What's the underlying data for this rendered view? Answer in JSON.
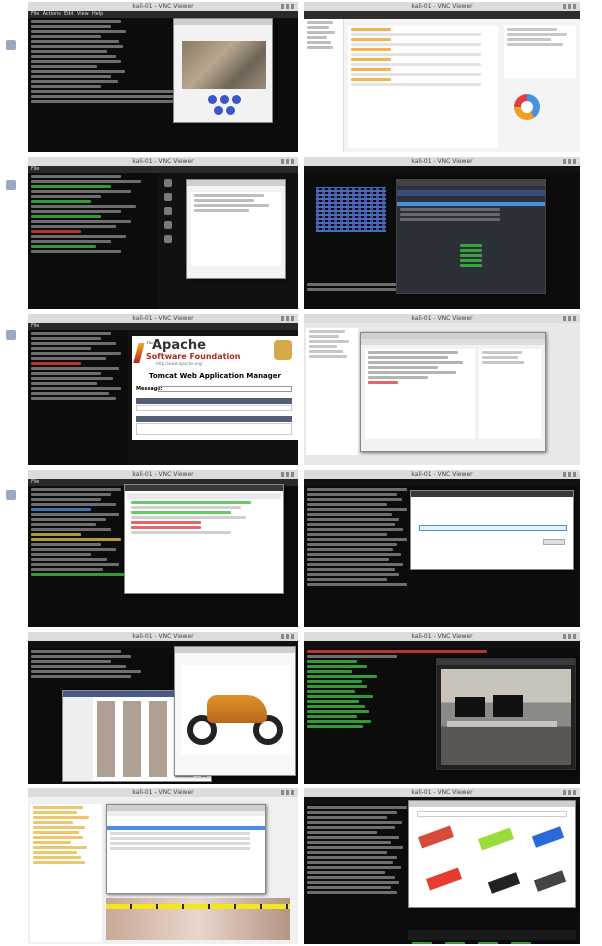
{
  "panels": [
    {
      "id": "shot-1",
      "window_title": "kali-01 - VNC Viewer",
      "content": "terminal-with-image-viewer"
    },
    {
      "id": "shot-2",
      "window_title": "kali-01 - VNC Viewer",
      "content": "dashboard"
    },
    {
      "id": "shot-3",
      "window_title": "kali-01 - VNC Viewer",
      "content": "terminal-with-dialog"
    },
    {
      "id": "shot-4",
      "window_title": "kali-01 - VNC Viewer",
      "content": "ascii-art-and-table"
    },
    {
      "id": "shot-5",
      "window_title": "kali-01 - VNC Viewer",
      "content": "tomcat-manager"
    },
    {
      "id": "shot-6",
      "window_title": "kali-01 - VNC Viewer",
      "content": "proxy-tool"
    },
    {
      "id": "shot-7",
      "window_title": "kali-01 - VNC Viewer",
      "content": "terminal-and-browser"
    },
    {
      "id": "shot-8",
      "window_title": "kali-01 - VNC Viewer",
      "content": "terminal-and-web-form"
    },
    {
      "id": "shot-9",
      "window_title": "kali-01 - VNC Viewer",
      "content": "file-browser-with-photo"
    },
    {
      "id": "shot-10",
      "window_title": "kali-01 - VNC Viewer",
      "content": "terminal-with-webcam-photo"
    },
    {
      "id": "shot-11",
      "window_title": "kali-01 - VNC Viewer",
      "content": "file-manager"
    },
    {
      "id": "shot-12",
      "window_title": "kali-01 - VNC Viewer",
      "content": "terminal-and-image-search"
    }
  ],
  "menu_labels": [
    "File",
    "Actions",
    "Edit",
    "View",
    "Help"
  ],
  "tomcat": {
    "brand_small": "The",
    "brand_line1": "Apache",
    "brand_line2": "Software Foundation",
    "url": "http://www.apache.org/",
    "title": "Tomcat Web Application Manager",
    "message_label": "Message:"
  },
  "colors": {
    "terminal_bg": "#0c0c0c",
    "accent_green": "#3fbf3f",
    "accent_red": "#e04040",
    "accent_blue": "#4a8fe0",
    "tomcat_red": "#b2281e",
    "dashboard_orange": "#f0a020"
  }
}
